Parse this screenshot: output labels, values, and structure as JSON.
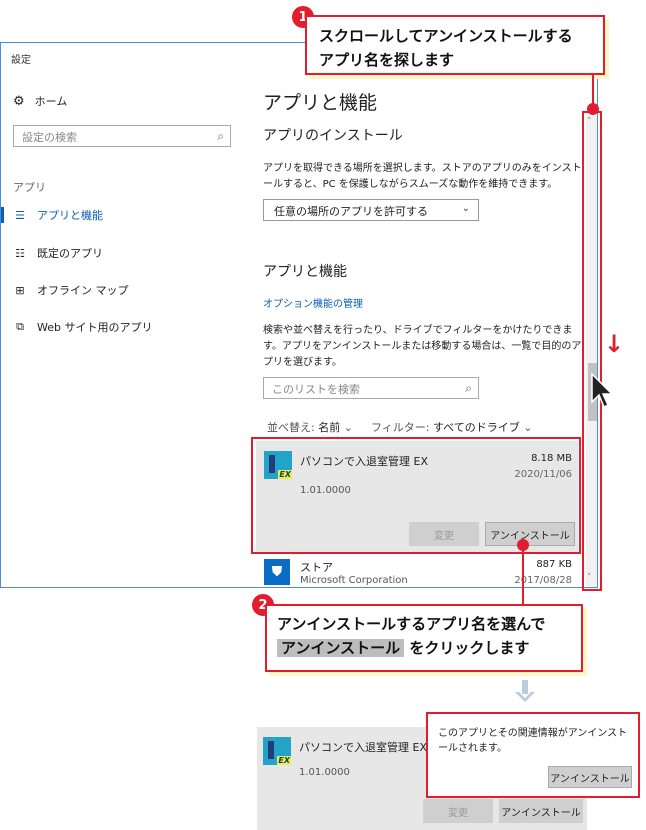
{
  "window": {
    "title": "設定"
  },
  "sidebar": {
    "home_label": "ホーム",
    "search_placeholder": "設定の検索",
    "section_label": "アプリ",
    "items": [
      {
        "label": "アプリと機能",
        "icon": "apps-list-icon",
        "active": true
      },
      {
        "label": "既定のアプリ",
        "icon": "default-apps-icon",
        "active": false
      },
      {
        "label": "オフライン マップ",
        "icon": "offline-map-icon",
        "active": false
      },
      {
        "label": "Web サイト用のアプリ",
        "icon": "website-apps-icon",
        "active": false
      }
    ]
  },
  "main": {
    "title": "アプリと機能",
    "install_heading": "アプリのインストール",
    "install_desc": "アプリを取得できる場所を選択します。ストアのアプリのみをインストールすると、PC を保護しながらスムーズな動作を維持できます。",
    "install_select_value": "任意の場所のアプリを許可する",
    "apps_heading": "アプリと機能",
    "optional_features_link": "オプション機能の管理",
    "apps_desc": "検索や並べ替えを行ったり、ドライブでフィルターをかけたりできます。アプリをアンインストールまたは移動する場合は、一覧で目的のアプリを選びます。",
    "list_search_placeholder": "このリストを検索",
    "sort_label": "並べ替え:",
    "sort_value": "名前",
    "filter_label": "フィルター:",
    "filter_value": "すべてのドライブ",
    "apps": [
      {
        "name": "パソコンで入退室管理 EX",
        "size": "8.18 MB",
        "date": "2020/11/06",
        "version": "1.01.0000",
        "icon_badge": "EX"
      },
      {
        "name": "ストア",
        "publisher": "Microsoft Corporation",
        "size": "887 KB",
        "date": "2017/08/28"
      }
    ],
    "modify_button": "変更",
    "uninstall_button": "アンインストール"
  },
  "annotations": {
    "step1_number": "1",
    "step1_text_line1": "スクロールしてアンインストールする",
    "step1_text_line2": "アプリ名を探します",
    "scroll_arrow": "↓",
    "step2_number": "2",
    "step2_text_line1": "アンインストールするアプリ名を選んで",
    "step2_highlight": "アンインストール",
    "step2_text_line2_suffix": "をクリックします",
    "accent_color": "#e21d2e"
  },
  "result": {
    "app_name": "パソコンで入退室管理 EX",
    "version": "1.01.0000",
    "icon_badge": "EX",
    "modify_button": "変更",
    "uninstall_button": "アンインストール",
    "dialog_text": "このアプリとその関連情報がアンインストールされます。",
    "dialog_button": "アンインストール"
  }
}
